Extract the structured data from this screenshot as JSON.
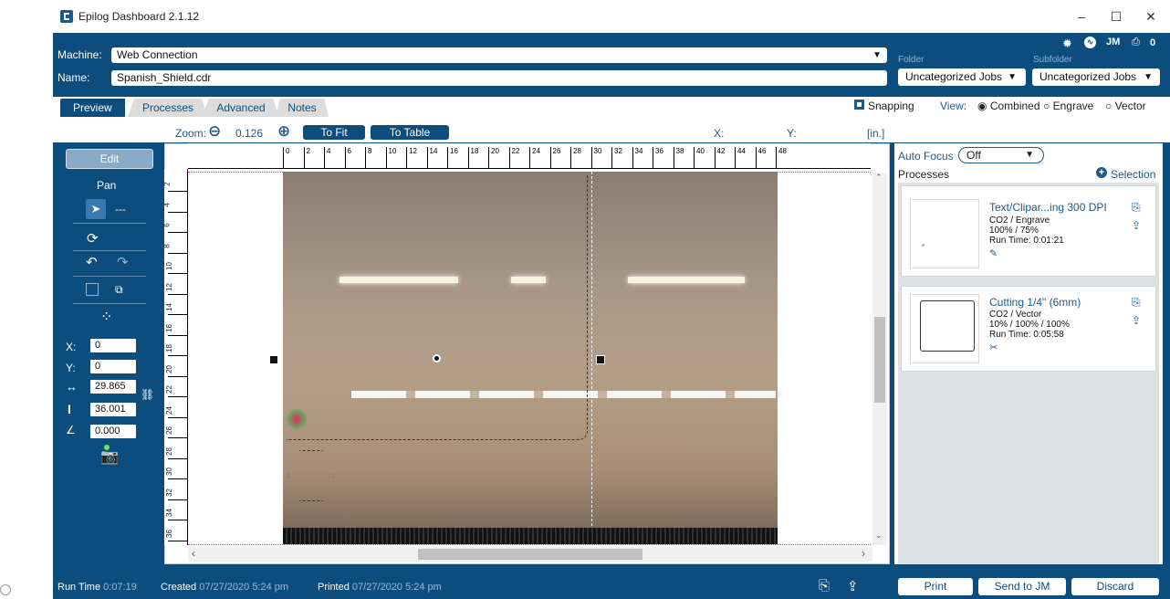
{
  "window": {
    "title": "Epilog Dashboard 2.1.12",
    "minimize": "–",
    "maximize": "☐",
    "close": "✕"
  },
  "header": {
    "machine_label": "Machine:",
    "machine_value": "Web Connection",
    "name_label": "Name:",
    "name_value": "Spanish_Shield.cdr",
    "folder_label": "Folder",
    "folder_value": "Uncategorized Jobs",
    "subfolder_label": "Subfolder",
    "subfolder_value": "Uncategorized Jobs",
    "user_initials": "JM",
    "print_count": "0"
  },
  "tabs": [
    "Preview",
    "Processes",
    "Advanced",
    "Notes"
  ],
  "view": {
    "snapping_label": "Snapping",
    "view_label": "View:",
    "options": [
      "Combined",
      "Engrave",
      "Vector"
    ],
    "selected": "Combined"
  },
  "zoom": {
    "label": "Zoom:",
    "value": "0.126",
    "to_fit": "To Fit",
    "to_table": "To Table",
    "x_label": "X:",
    "y_label": "Y:",
    "units": "[in.]"
  },
  "ruler": {
    "horizontal": [
      "0",
      "2",
      "4",
      "6",
      "8",
      "10",
      "12",
      "14",
      "16",
      "18",
      "20",
      "22",
      "24",
      "26",
      "28",
      "30",
      "32",
      "34",
      "36",
      "38",
      "40",
      "42",
      "44",
      "46",
      "48"
    ],
    "vertical": [
      "2",
      "4",
      "6",
      "8",
      "10",
      "12",
      "14",
      "16",
      "18",
      "20",
      "22",
      "24",
      "26",
      "28",
      "30",
      "32",
      "34",
      "36"
    ]
  },
  "tools": {
    "edit": "Edit",
    "pan": "Pan",
    "dashes": "---",
    "x_label": "X:",
    "x_value": "0",
    "y_label": "Y:",
    "y_value": "0",
    "width_value": "29.865",
    "height_value": "36.001",
    "angle_value": "0.000"
  },
  "right": {
    "auto_focus_label": "Auto Focus",
    "auto_focus_value": "Off",
    "processes_label": "Processes",
    "selection_label": "Selection",
    "processes": [
      {
        "title": "Text/Clipar...ing 300 DPI",
        "line1": "CO2 / Engrave",
        "line2": "100% / 75%",
        "line3": "Run Time: 0:01:21"
      },
      {
        "title": "Cutting 1/4\" (6mm)",
        "line1": "CO2 / Vector",
        "line2": "10% / 100% / 100%",
        "line3": "Run Time: 0:05:58"
      }
    ]
  },
  "status": {
    "runtime_label": "Run Time",
    "runtime_value": "0:07:19",
    "created_label": "Created",
    "created_value": "07/27/2020 5:24 pm",
    "printed_label": "Printed",
    "printed_value": "07/27/2020 5:24 pm",
    "print_button": "Print",
    "send_button": "Send to JM",
    "discard_button": "Discard"
  },
  "colors": {
    "primary": "#0d4d7d",
    "accent": "#1d5a8c"
  }
}
